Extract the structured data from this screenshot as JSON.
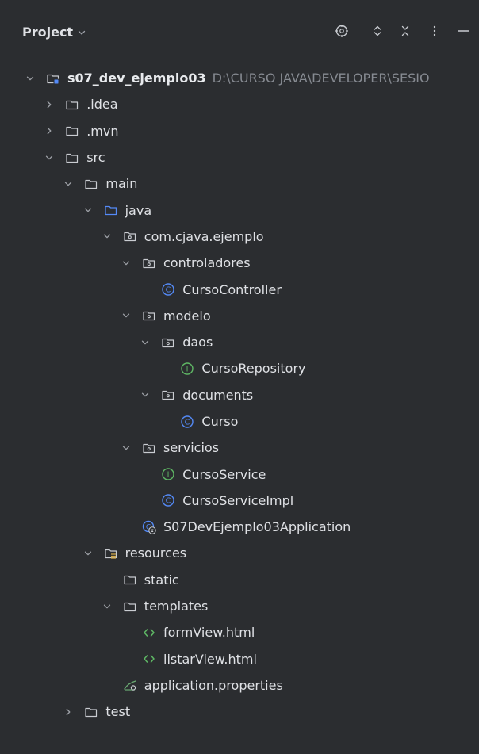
{
  "header": {
    "title": "Project",
    "icons": [
      "target-icon",
      "expand-icon",
      "collapse-icon",
      "more-icon",
      "minimize-icon"
    ]
  },
  "tree": [
    {
      "label": "s07_dev_ejemplo03",
      "path": "D:\\CURSO JAVA\\DEVELOPER\\SESIO",
      "icon": "module-folder-icon",
      "expanded": true,
      "level": 0
    },
    {
      "label": ".idea",
      "icon": "folder-icon",
      "expanded": false,
      "level": 1
    },
    {
      "label": ".mvn",
      "icon": "folder-icon",
      "expanded": false,
      "level": 1
    },
    {
      "label": "src",
      "icon": "folder-icon",
      "expanded": true,
      "level": 1
    },
    {
      "label": "main",
      "icon": "folder-icon",
      "expanded": true,
      "level": 2
    },
    {
      "label": "java",
      "icon": "source-folder-icon",
      "expanded": true,
      "level": 3
    },
    {
      "label": "com.cjava.ejemplo",
      "icon": "package-icon",
      "expanded": true,
      "level": 4
    },
    {
      "label": "controladores",
      "icon": "package-icon",
      "expanded": true,
      "level": 5
    },
    {
      "label": "CursoController",
      "icon": "class-icon",
      "level": 6
    },
    {
      "label": "modelo",
      "icon": "package-icon",
      "expanded": true,
      "level": 5
    },
    {
      "label": "daos",
      "icon": "package-icon",
      "expanded": true,
      "level": 6
    },
    {
      "label": "CursoRepository",
      "icon": "interface-icon",
      "level": 7
    },
    {
      "label": "documents",
      "icon": "package-icon",
      "expanded": true,
      "level": 6
    },
    {
      "label": "Curso",
      "icon": "class-icon",
      "level": 7
    },
    {
      "label": "servicios",
      "icon": "package-icon",
      "expanded": true,
      "level": 5
    },
    {
      "label": "CursoService",
      "icon": "interface-icon",
      "level": 6
    },
    {
      "label": "CursoServiceImpl",
      "icon": "class-icon",
      "level": 6
    },
    {
      "label": "S07DevEjemplo03Application",
      "icon": "spring-app-icon",
      "level": 5
    },
    {
      "label": "resources",
      "icon": "resources-folder-icon",
      "expanded": true,
      "level": 3
    },
    {
      "label": "static",
      "icon": "folder-icon",
      "level": 4
    },
    {
      "label": "templates",
      "icon": "folder-icon",
      "expanded": true,
      "level": 4
    },
    {
      "label": "formView.html",
      "icon": "html-icon",
      "level": 5
    },
    {
      "label": "listarView.html",
      "icon": "html-icon",
      "level": 5
    },
    {
      "label": "application.properties",
      "icon": "properties-icon",
      "level": 4
    },
    {
      "label": "test",
      "icon": "folder-icon",
      "expanded": false,
      "level": 2
    }
  ],
  "colors": {
    "background": "#2b2d30",
    "text": "#dfe1e5",
    "path_text": "#868a91",
    "class_icon": "#548af7",
    "interface_icon": "#5fb865",
    "source_folder": "#548af7",
    "spring_icon": "#6aab73",
    "html_icon": "#5fb865",
    "resources_lines": "#d1a949"
  }
}
